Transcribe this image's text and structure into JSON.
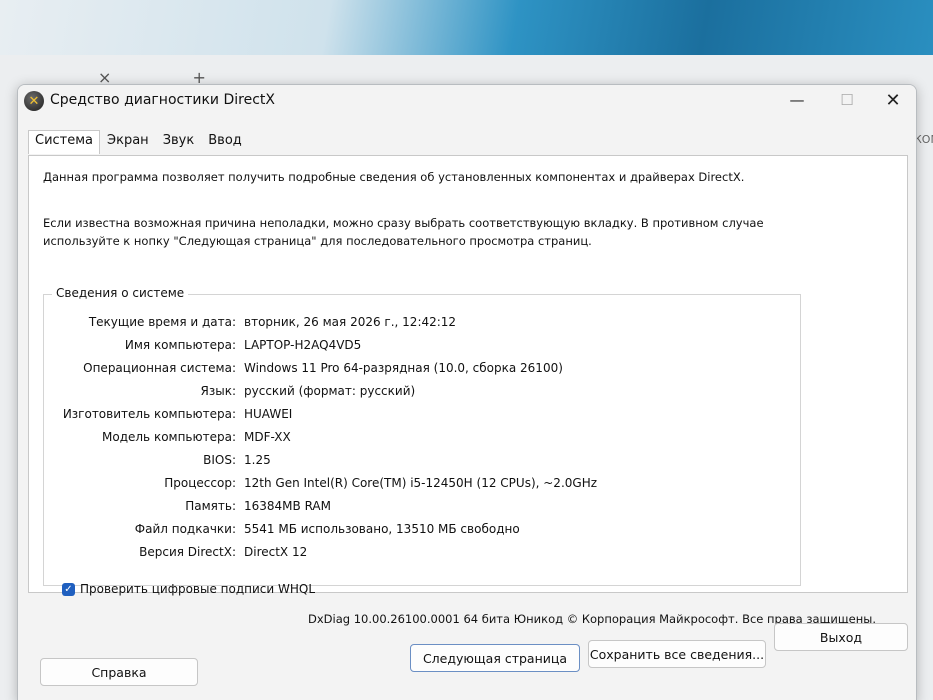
{
  "window": {
    "title": "Средство диагностики DirectX",
    "controls": {
      "minimize": "—",
      "maximize": "☐",
      "close": "✕"
    }
  },
  "tabs": [
    {
      "label": "Система",
      "active": true
    },
    {
      "label": "Экран",
      "active": false
    },
    {
      "label": "Звук",
      "active": false
    },
    {
      "label": "Ввод",
      "active": false
    }
  ],
  "intro": {
    "line1": "Данная программа позволяет получить подробные сведения об установленных компонентах и драйверах DirectX.",
    "line2": "Если известна возможная причина неполадки, можно сразу выбрать соответствующую вкладку. В противном случае используйте к нопку \"Следующая страница\" для последовательного просмотра страниц."
  },
  "system_info": {
    "group_title": "Сведения о системе",
    "rows": [
      {
        "label": "Текущие время и дата:",
        "value": "вторник, 26 мая 2026 г., 12:42:12"
      },
      {
        "label": "Имя компьютера:",
        "value": "LAPTOP-H2AQ4VD5"
      },
      {
        "label": "Операционная система:",
        "value": "Windows 11 Pro 64-разрядная (10.0, сборка 26100)"
      },
      {
        "label": "Язык:",
        "value": "русский (формат: русский)"
      },
      {
        "label": "Изготовитель компьютера:",
        "value": "HUAWEI"
      },
      {
        "label": "Модель компьютера:",
        "value": "MDF-XX"
      },
      {
        "label": "BIOS:",
        "value": "1.25"
      },
      {
        "label": "Процессор:",
        "value": "12th Gen Intel(R) Core(TM) i5-12450H (12 CPUs), ~2.0GHz"
      },
      {
        "label": "Память:",
        "value": "16384MB RAM"
      },
      {
        "label": "Файл подкачки:",
        "value": "5541 МБ использовано, 13510 МБ свободно"
      },
      {
        "label": "Версия DirectX:",
        "value": "DirectX 12"
      }
    ]
  },
  "whql_checkbox": {
    "label": "Проверить цифровые подписи WHQL",
    "checked": true,
    "mark": "✓"
  },
  "copyright": "DxDiag 10.00.26100.0001 64 бита Юникод © Корпорация Майкрософт. Все права защищены.",
  "buttons": {
    "help": "Справка",
    "next": "Следующая страница",
    "save": "Сохранить все сведения...",
    "exit": "Выход"
  },
  "background": {
    "tab_glyphs": "× +",
    "side_text": "КОМ",
    "app_icon_glyph": "✕"
  }
}
